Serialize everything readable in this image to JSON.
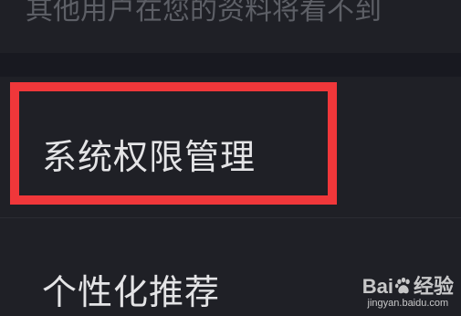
{
  "header": {
    "privacy_text": "其他用户在您的资料将看不到"
  },
  "settings": {
    "items": [
      {
        "label": "系统权限管理"
      },
      {
        "label": "个性化推荐"
      }
    ]
  },
  "watermark": {
    "brand_left": "Bai",
    "brand_right": "经验",
    "url": "jingyan.baidu.com"
  },
  "colors": {
    "background": "#1f2026",
    "divider": "#181920",
    "text_primary": "#e4e4e6",
    "text_muted": "#5d5f66",
    "highlight": "#f0373a"
  }
}
